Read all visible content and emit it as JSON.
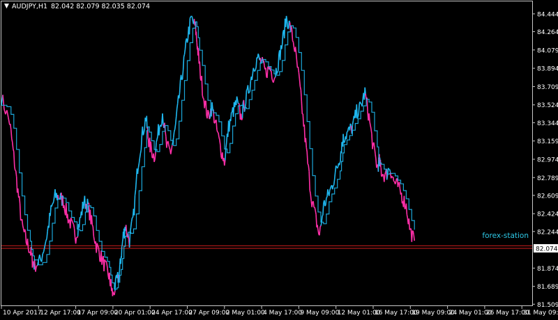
{
  "header": {
    "symbol": "AUDJPY,H1",
    "quote": "82.042 82.079 82.035 82.074"
  },
  "watermark": "forex-station",
  "colors": {
    "background": "#000000",
    "frame": "#c8c8c8",
    "up": "#1fb8f0",
    "down": "#ff2fa8",
    "price_line": "#d21e1e",
    "price_tag_bg": "#ffffff",
    "price_tag_text": "#000000",
    "watermark": "#2ec8e6",
    "axis_text": "#ffffff"
  },
  "chart_data": {
    "type": "line",
    "title": "",
    "xlabel": "",
    "ylabel": "",
    "ylim": [
      81.49,
      84.57
    ],
    "y_ticks": [
      "84.444",
      "84.264",
      "84.079",
      "83.894",
      "83.709",
      "83.524",
      "83.344",
      "83.159",
      "82.974",
      "82.789",
      "82.609",
      "82.424",
      "82.244",
      "82.074",
      "81.874",
      "81.689",
      "81.509"
    ],
    "current_price": 82.074,
    "reference_level": 82.1,
    "x_ticks": [
      "10 Apr 2017",
      "12 Apr 17:00",
      "17 Apr 09:00",
      "20 Apr 01:00",
      "24 Apr 17:00",
      "27 Apr 09:00",
      "2 May 01:00",
      "4 May 17:00",
      "9 May 09:00",
      "12 May 01:00",
      "16 May 17:00",
      "19 May 09:00",
      "24 May 01:00",
      "26 May 17:00",
      "31 May 09:00"
    ],
    "x_tick_positions": [
      0,
      36,
      72,
      108,
      144,
      180,
      216,
      252,
      288,
      324,
      360,
      396,
      432,
      468,
      504
    ],
    "x_range": [
      0,
      514
    ],
    "x": [
      0,
      8,
      12,
      16,
      20,
      24,
      28,
      30,
      32,
      38,
      44,
      48,
      52,
      56,
      60,
      64,
      68,
      72,
      76,
      80,
      84,
      88,
      92,
      96,
      100,
      104,
      106,
      108,
      112,
      114,
      116,
      118,
      120,
      124,
      128,
      132,
      136,
      140,
      142,
      144,
      148,
      152,
      156,
      160,
      164,
      168,
      172,
      176,
      180,
      184,
      188,
      190,
      192,
      196,
      200,
      204,
      208,
      212,
      216,
      220,
      224,
      228,
      232,
      236,
      240,
      244,
      248,
      252,
      256,
      260,
      264,
      268,
      272,
      276,
      280,
      284,
      288,
      292,
      296,
      300,
      304,
      308,
      312,
      316,
      320,
      324,
      328,
      330,
      332,
      336,
      340,
      344,
      348,
      352,
      356,
      360,
      364,
      366,
      368,
      372,
      376,
      380,
      384,
      388,
      392,
      396,
      400,
      404,
      408,
      412,
      416,
      420,
      424,
      428,
      432,
      436,
      440,
      444,
      448,
      452,
      456,
      460,
      464,
      468,
      472,
      476,
      480,
      484,
      488,
      492,
      496,
      500,
      504,
      508,
      512
    ],
    "series": [
      {
        "role": "close",
        "values": [
          83.6,
          83.35,
          83.0,
          82.65,
          82.3,
          82.15,
          82.05,
          81.95,
          81.9,
          81.95,
          82.2,
          82.45,
          82.6,
          82.6,
          82.55,
          82.4,
          82.3,
          82.2,
          82.35,
          82.55,
          82.5,
          82.3,
          82.1,
          82.0,
          81.9,
          81.8,
          81.7,
          81.6,
          81.75,
          81.8,
          82.0,
          82.2,
          82.3,
          82.15,
          82.4,
          82.9,
          83.2,
          83.4,
          83.2,
          83.1,
          83.0,
          83.25,
          83.45,
          83.1,
          83.05,
          83.25,
          83.6,
          83.9,
          84.2,
          84.4,
          84.3,
          84.1,
          83.9,
          83.6,
          83.4,
          83.5,
          83.3,
          83.1,
          82.95,
          83.3,
          83.45,
          83.55,
          83.4,
          83.55,
          83.7,
          83.9,
          84.0,
          83.95,
          83.85,
          83.9,
          83.8,
          83.95,
          84.15,
          84.4,
          84.3,
          84.1,
          83.8,
          83.4,
          83.0,
          82.6,
          82.4,
          82.2,
          82.5,
          82.6,
          82.7,
          82.85,
          83.0,
          83.15,
          83.2,
          83.25,
          83.3,
          83.45,
          83.5,
          83.65,
          83.4,
          83.1,
          82.9,
          82.95,
          82.85,
          82.8,
          82.9,
          82.75,
          82.7,
          82.6,
          82.5,
          82.25,
          82.15
        ],
        "values_note": ""
      },
      {
        "role": "stepline",
        "values": []
      }
    ]
  }
}
